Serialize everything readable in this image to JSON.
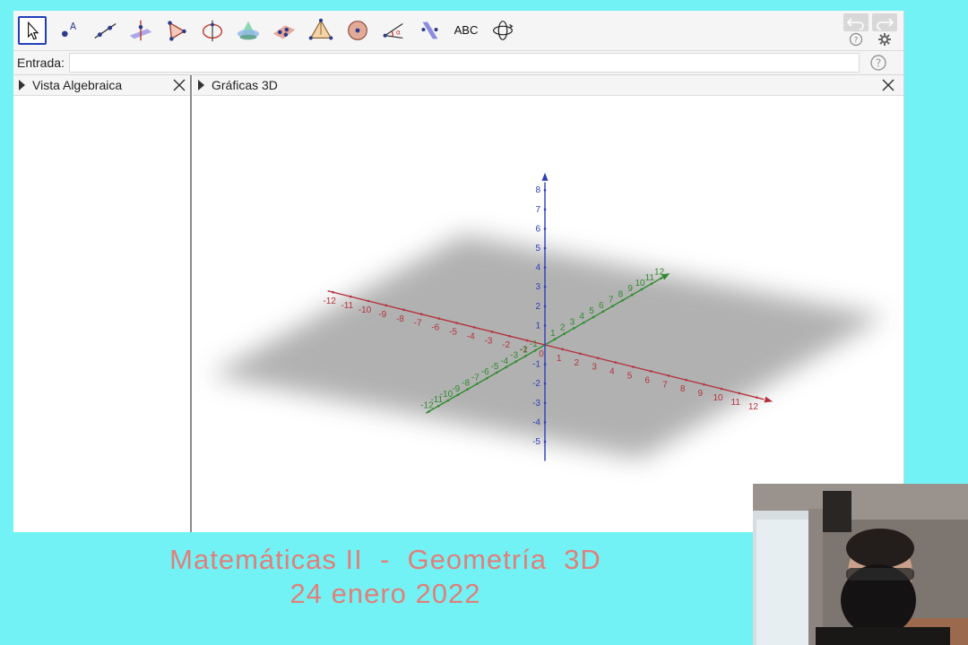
{
  "toolbar": {
    "tools": [
      {
        "name": "move-tool",
        "icon": "cursor-arrow-icon"
      },
      {
        "name": "point-tool",
        "icon": "point-icon"
      },
      {
        "name": "line-tool",
        "icon": "line-through-points-icon"
      },
      {
        "name": "perpendicular-tool",
        "icon": "perpendicular-line-icon"
      },
      {
        "name": "polygon-tool",
        "icon": "polygon-icon"
      },
      {
        "name": "circle-axis-tool",
        "icon": "circle-around-axis-icon"
      },
      {
        "name": "intersect-surfaces-tool",
        "icon": "intersect-surfaces-icon"
      },
      {
        "name": "plane-points-tool",
        "icon": "plane-through-points-icon"
      },
      {
        "name": "pyramid-tool",
        "icon": "pyramid-icon"
      },
      {
        "name": "sphere-tool",
        "icon": "sphere-icon"
      },
      {
        "name": "angle-tool",
        "icon": "angle-icon"
      },
      {
        "name": "reflect-tool",
        "icon": "reflect-about-plane-icon"
      },
      {
        "name": "text-tool",
        "icon": "text-abc-icon",
        "label": "ABC"
      },
      {
        "name": "rotate-view-tool",
        "icon": "rotate-3d-view-icon"
      }
    ],
    "undo_icon": "undo-icon",
    "redo_icon": "redo-icon"
  },
  "input_bar": {
    "label": "Entrada:",
    "value": "",
    "placeholder": ""
  },
  "panels": {
    "algebra": {
      "title": "Vista Algebraica"
    },
    "graphics": {
      "title": "Gráficas 3D"
    }
  },
  "axes": {
    "x": {
      "color": "#b5333d",
      "min": -12,
      "max": 12,
      "labels": [
        "-12",
        "-11",
        "-10",
        "-9",
        "-8",
        "-7",
        "-6",
        "-5",
        "-4",
        "-3",
        "-2",
        "-1",
        "0",
        "1",
        "2",
        "3",
        "4",
        "5",
        "6",
        "7",
        "8",
        "9",
        "10",
        "11",
        "12"
      ]
    },
    "y": {
      "color": "#2e8b2e",
      "min": -12,
      "max": 12,
      "labels": [
        "-12",
        "-11",
        "-10",
        "-9",
        "-8",
        "-7",
        "-6",
        "-5",
        "-4",
        "-3",
        "-2",
        "-1",
        "1",
        "2",
        "3",
        "4",
        "5",
        "6",
        "7",
        "8",
        "9",
        "10",
        "11",
        "12"
      ]
    },
    "z": {
      "color": "#2f3db8",
      "min": -5,
      "max": 8,
      "labels": [
        "-5",
        "-4",
        "-3",
        "-2",
        "-1",
        "1",
        "2",
        "3",
        "4",
        "5",
        "6",
        "7",
        "8"
      ]
    }
  },
  "caption": {
    "line1": "Matemáticas II  -  Geometría  3D",
    "line2": "24 enero 2022"
  },
  "colors": {
    "background": "#73f2f5",
    "caption": "#e07f7a",
    "active_tool_border": "#1f3fb6"
  }
}
